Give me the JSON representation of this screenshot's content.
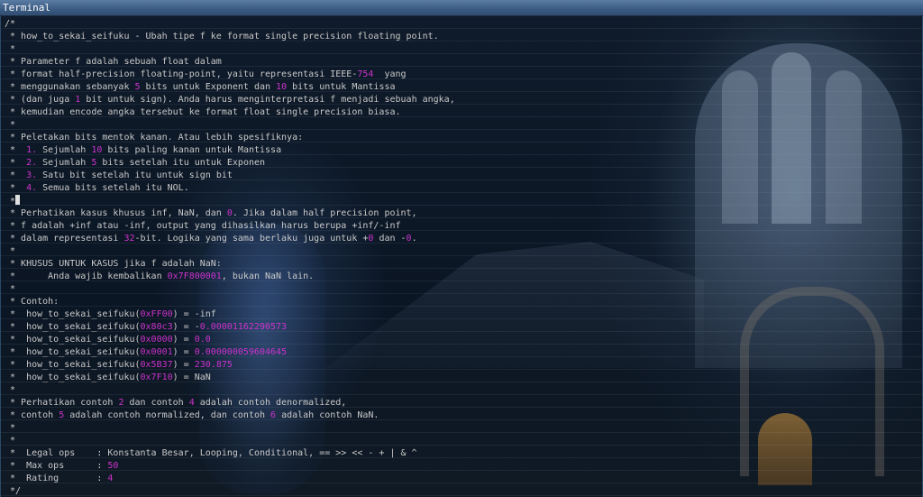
{
  "window": {
    "title": "Terminal"
  },
  "colors": {
    "text": "#c9c9c9",
    "number": "#cc33cc",
    "titlebar": "#3d5d85"
  },
  "code_lines": [
    [
      {
        "t": "/*"
      }
    ],
    [
      {
        "t": " * how_to_sekai_seifuku - Ubah tipe f ke format single precision floating point."
      }
    ],
    [
      {
        "t": " *"
      }
    ],
    [
      {
        "t": " * Parameter f adalah sebuah float dalam"
      }
    ],
    [
      {
        "t": " * format half-precision floating-point, yaitu representasi IEEE-"
      },
      {
        "t": "754",
        "n": true
      },
      {
        "t": "  yang"
      }
    ],
    [
      {
        "t": " * menggunakan sebanyak "
      },
      {
        "t": "5",
        "n": true
      },
      {
        "t": " bits untuk Exponent dan "
      },
      {
        "t": "10",
        "n": true
      },
      {
        "t": " bits untuk Mantissa"
      }
    ],
    [
      {
        "t": " * (dan juga "
      },
      {
        "t": "1",
        "n": true
      },
      {
        "t": " bit untuk sign). Anda harus menginterpretasi f menjadi sebuah angka,"
      }
    ],
    [
      {
        "t": " * kemudian encode angka tersebut ke format float single precision biasa."
      }
    ],
    [
      {
        "t": " *"
      }
    ],
    [
      {
        "t": " * Peletakan bits mentok kanan. Atau lebih spesifiknya:"
      }
    ],
    [
      {
        "t": " *  "
      },
      {
        "t": "1.",
        "n": true
      },
      {
        "t": " Sejumlah "
      },
      {
        "t": "10",
        "n": true
      },
      {
        "t": " bits paling kanan untuk Mantissa"
      }
    ],
    [
      {
        "t": " *  "
      },
      {
        "t": "2.",
        "n": true
      },
      {
        "t": " Sejumlah "
      },
      {
        "t": "5",
        "n": true
      },
      {
        "t": " bits setelah itu untuk Exponen"
      }
    ],
    [
      {
        "t": " *  "
      },
      {
        "t": "3.",
        "n": true
      },
      {
        "t": " Satu bit setelah itu untuk sign bit"
      }
    ],
    [
      {
        "t": " *  "
      },
      {
        "t": "4.",
        "n": true
      },
      {
        "t": " Semua bits setelah itu NOL."
      }
    ],
    [
      {
        "t": " *"
      },
      {
        "cursor": true
      }
    ],
    [
      {
        "t": " * Perhatikan kasus khusus inf, NaN, dan "
      },
      {
        "t": "0",
        "n": true
      },
      {
        "t": ". Jika dalam half precision point,"
      }
    ],
    [
      {
        "t": " * f adalah +inf atau -inf, output yang dihasilkan harus berupa +inf/-inf"
      }
    ],
    [
      {
        "t": " * dalam representasi "
      },
      {
        "t": "32",
        "n": true
      },
      {
        "t": "-bit. Logika yang sama berlaku juga untuk +"
      },
      {
        "t": "0",
        "n": true
      },
      {
        "t": " dan -"
      },
      {
        "t": "0",
        "n": true
      },
      {
        "t": "."
      }
    ],
    [
      {
        "t": " *"
      }
    ],
    [
      {
        "t": " * KHUSUS UNTUK KASUS jika f adalah NaN:"
      }
    ],
    [
      {
        "t": " *      Anda wajib kembalikan "
      },
      {
        "t": "0x7F800001",
        "n": true
      },
      {
        "t": ", bukan NaN lain."
      }
    ],
    [
      {
        "t": " *"
      }
    ],
    [
      {
        "t": " * Contoh:"
      }
    ],
    [
      {
        "t": " *  how_to_sekai_seifuku("
      },
      {
        "t": "0xFF00",
        "n": true
      },
      {
        "t": ") = -inf"
      }
    ],
    [
      {
        "t": " *  how_to_sekai_seifuku("
      },
      {
        "t": "0x80c3",
        "n": true
      },
      {
        "t": ") = -"
      },
      {
        "t": "0.00001162290573",
        "n": true
      }
    ],
    [
      {
        "t": " *  how_to_sekai_seifuku("
      },
      {
        "t": "0x0000",
        "n": true
      },
      {
        "t": ") = "
      },
      {
        "t": "0.0",
        "n": true
      }
    ],
    [
      {
        "t": " *  how_to_sekai_seifuku("
      },
      {
        "t": "0x0001",
        "n": true
      },
      {
        "t": ") = "
      },
      {
        "t": "0.000000059604645",
        "n": true
      }
    ],
    [
      {
        "t": " *  how_to_sekai_seifuku("
      },
      {
        "t": "0x5B37",
        "n": true
      },
      {
        "t": ") = "
      },
      {
        "t": "230.875",
        "n": true
      }
    ],
    [
      {
        "t": " *  how_to_sekai_seifuku("
      },
      {
        "t": "0x7F10",
        "n": true
      },
      {
        "t": ") = NaN"
      }
    ],
    [
      {
        "t": " *"
      }
    ],
    [
      {
        "t": " * Perhatikan contoh "
      },
      {
        "t": "2",
        "n": true
      },
      {
        "t": " dan contoh "
      },
      {
        "t": "4",
        "n": true
      },
      {
        "t": " adalah contoh denormalized,"
      }
    ],
    [
      {
        "t": " * contoh "
      },
      {
        "t": "5",
        "n": true
      },
      {
        "t": " adalah contoh normalized, dan contoh "
      },
      {
        "t": "6",
        "n": true
      },
      {
        "t": " adalah contoh NaN."
      }
    ],
    [
      {
        "t": " *"
      }
    ],
    [
      {
        "t": " *"
      }
    ],
    [
      {
        "t": " *  Legal ops    : Konstanta Besar, Looping, Conditional, == >> << - + | & ^"
      }
    ],
    [
      {
        "t": " *  Max ops      : "
      },
      {
        "t": "50",
        "n": true
      }
    ],
    [
      {
        "t": " *  Rating       : "
      },
      {
        "t": "4",
        "n": true
      }
    ],
    [
      {
        "t": " */"
      }
    ]
  ]
}
